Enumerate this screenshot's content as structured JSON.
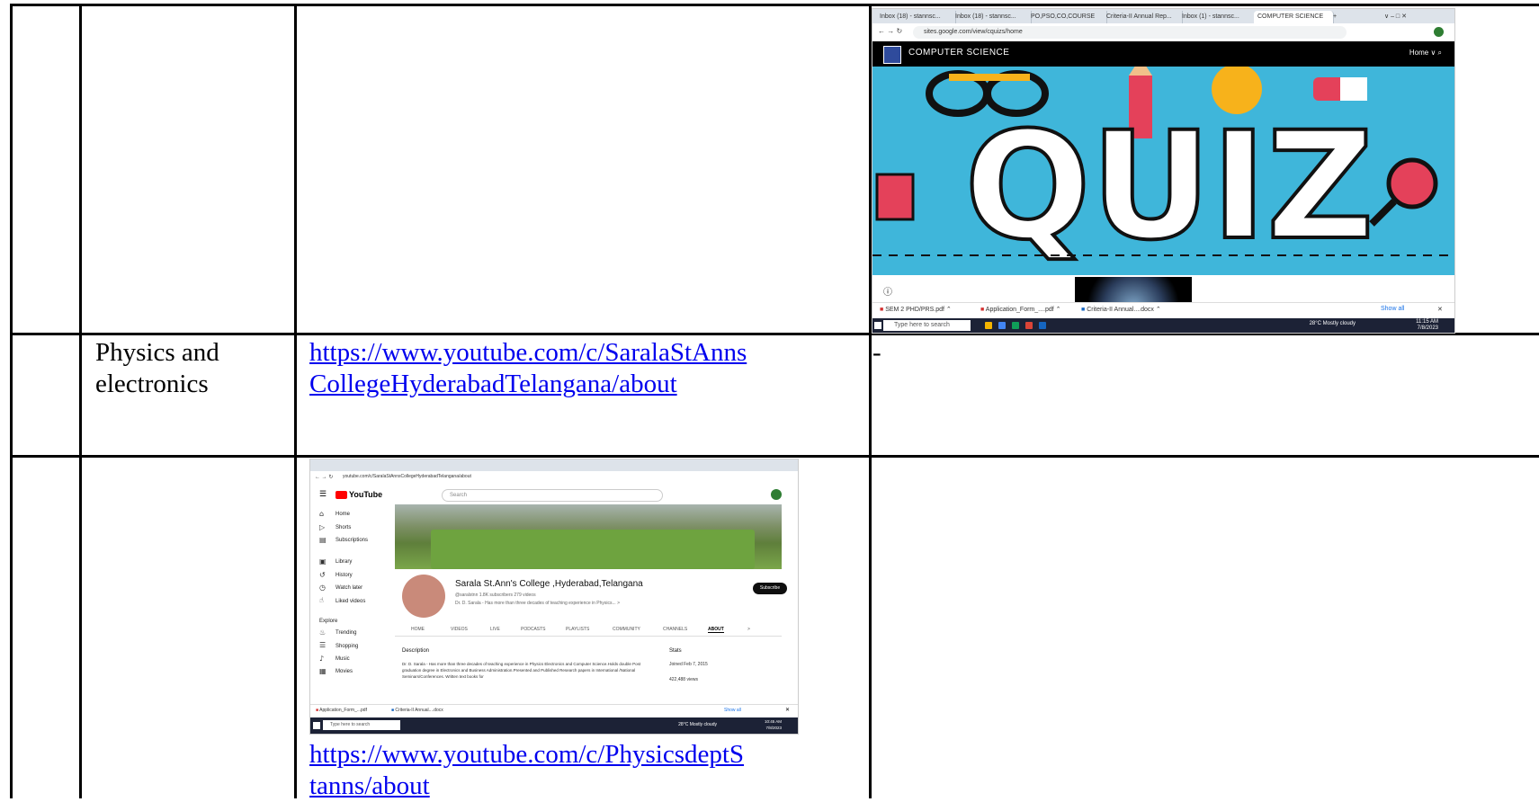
{
  "table": {
    "rows": [
      {
        "subject": "",
        "link_lines": [],
        "screenshot_caption": ""
      },
      {
        "subject_lines": [
          "Physics and",
          "electronics"
        ],
        "link_lines": [
          "https://www.youtube.com/c/SaralaStAnns",
          "CollegeHyderabadTelangana/about"
        ],
        "right_cell": "-"
      },
      {
        "link_lines": [
          "https://www.youtube.com/c/PhysicsdeptS",
          "tanns/about"
        ]
      }
    ]
  },
  "shot1": {
    "tabs": [
      "Inbox (18) - stannsc...",
      "Inbox (18) - stannsc...",
      "PO,PSO,CO,COURSE",
      "Criteria-II Annual Rep...",
      "Inbox (1) - stannsc...",
      "COMPUTER SCIENCE"
    ],
    "new_tab": "+",
    "window_controls": "∨  –  □  ✕",
    "url": "sites.google.com/view/cquizs/home",
    "site_title": "COMPUTER SCIENCE",
    "site_menu": "Home ∨  ⌕",
    "banner_word": "QUIZ",
    "downloads": [
      "SEM 2 PHD/PRS.pdf",
      "Application_Form_....pdf",
      "Criteria-II Annual....docx"
    ],
    "show_all": "Show all",
    "taskbar_search": "Type here to search",
    "weather": "28°C  Mostly cloudy",
    "time": "11:15 AM",
    "date": "7/8/2023"
  },
  "shot2": {
    "url": "youtube.com/c/SaralaStAnnsCollegeHyderabadTelangana/about",
    "logo": "YouTube",
    "search_placeholder": "Search",
    "side_items": [
      "Home",
      "Shorts",
      "Subscriptions",
      "Library",
      "History",
      "Watch later",
      "Liked videos",
      "Explore",
      "Trending",
      "Shopping",
      "Music",
      "Movies"
    ],
    "side_icons": [
      "⌂",
      "▷",
      "▤",
      "▣",
      "↺",
      "◷",
      "☝",
      "",
      "♨",
      "☰",
      "♪",
      "▦"
    ],
    "channel_name": "Sarala St.Ann's College ,Hyderabad,Telangana",
    "channel_meta": "@saralstnn  1.8K subscribers  279 videos",
    "channel_blurb": "Dr. D. Sarala - Has more than three decades of teaching experience in Physics...  >",
    "subscribe": "Subscribe",
    "nav_tabs": [
      "HOME",
      "VIDEOS",
      "LIVE",
      "PODCASTS",
      "PLAYLISTS",
      "COMMUNITY",
      "CHANNELS",
      "ABOUT",
      ">"
    ],
    "desc_heading": "Description",
    "description": "Dr. D. Sarala - Has more than three decades of teaching experience in Physics Electronics and Computer Science.Holds double Post graduation degree in Electronics and Business Administration.Presented and Published Research papers in International /National Seminars/Conferences. Written text books for",
    "stats_heading": "Stats",
    "joined": "Joined Feb 7, 2015",
    "views": "422,488 views",
    "downloads": [
      "Application_Form_...pdf",
      "Criteria-II Annual....docx"
    ],
    "show_all": "Show all",
    "taskbar_search": "Type here to search",
    "weather": "28°C  Mostly cloudy",
    "time": "10:45 AM",
    "date": "7/8/2023"
  }
}
